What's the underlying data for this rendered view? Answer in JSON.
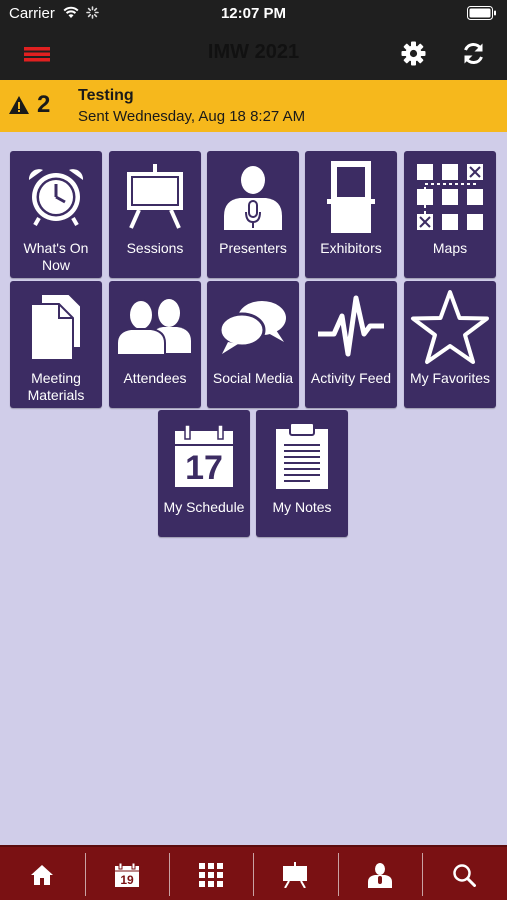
{
  "status_bar": {
    "carrier": "Carrier",
    "time": "12:07 PM"
  },
  "header": {
    "title": "IMW 2021",
    "menu_icon": "hamburger-menu-icon",
    "settings_icon": "gear-icon",
    "refresh_icon": "refresh-icon"
  },
  "alert": {
    "count": "2",
    "title": "Testing",
    "subtitle": "Sent Wednesday, Aug 18 8:27 AM",
    "icon": "warning-icon"
  },
  "tiles": [
    {
      "label_line1": "What's On",
      "label_line2": "Now",
      "icon": "alarm-clock-icon"
    },
    {
      "label_line1": "Sessions",
      "label_line2": "",
      "icon": "easel-board-icon"
    },
    {
      "label_line1": "Presenters",
      "label_line2": "",
      "icon": "presenter-microphone-icon"
    },
    {
      "label_line1": "Exhibitors",
      "label_line2": "",
      "icon": "booth-icon"
    },
    {
      "label_line1": "Maps",
      "label_line2": "",
      "icon": "map-grid-icon"
    },
    {
      "label_line1": "Meeting",
      "label_line2": "Materials",
      "icon": "documents-icon"
    },
    {
      "label_line1": "Attendees",
      "label_line2": "",
      "icon": "people-icon"
    },
    {
      "label_line1": "Social Media",
      "label_line2": "",
      "icon": "chat-bubbles-icon"
    },
    {
      "label_line1": "Activity Feed",
      "label_line2": "",
      "icon": "pulse-icon"
    },
    {
      "label_line1": "My Favorites",
      "label_line2": "",
      "icon": "star-icon"
    },
    {
      "label_line1": "My Schedule",
      "label_line2": "",
      "icon": "calendar-icon",
      "calendar_day": "17"
    },
    {
      "label_line1": "My Notes",
      "label_line2": "",
      "icon": "notepad-icon"
    }
  ],
  "tab_bar": {
    "tabs": [
      {
        "icon": "home-icon"
      },
      {
        "icon": "calendar-icon",
        "calendar_day": "19"
      },
      {
        "icon": "grid-icon"
      },
      {
        "icon": "easel-board-icon"
      },
      {
        "icon": "presenter-icon"
      },
      {
        "icon": "search-icon"
      }
    ]
  },
  "colors": {
    "background": "#d0cde9",
    "header": "#1f1f1f",
    "menu_red": "#e02020",
    "alert": "#f6b81c",
    "tile": "#3c2c63",
    "tab_bar": "#7a1113"
  }
}
